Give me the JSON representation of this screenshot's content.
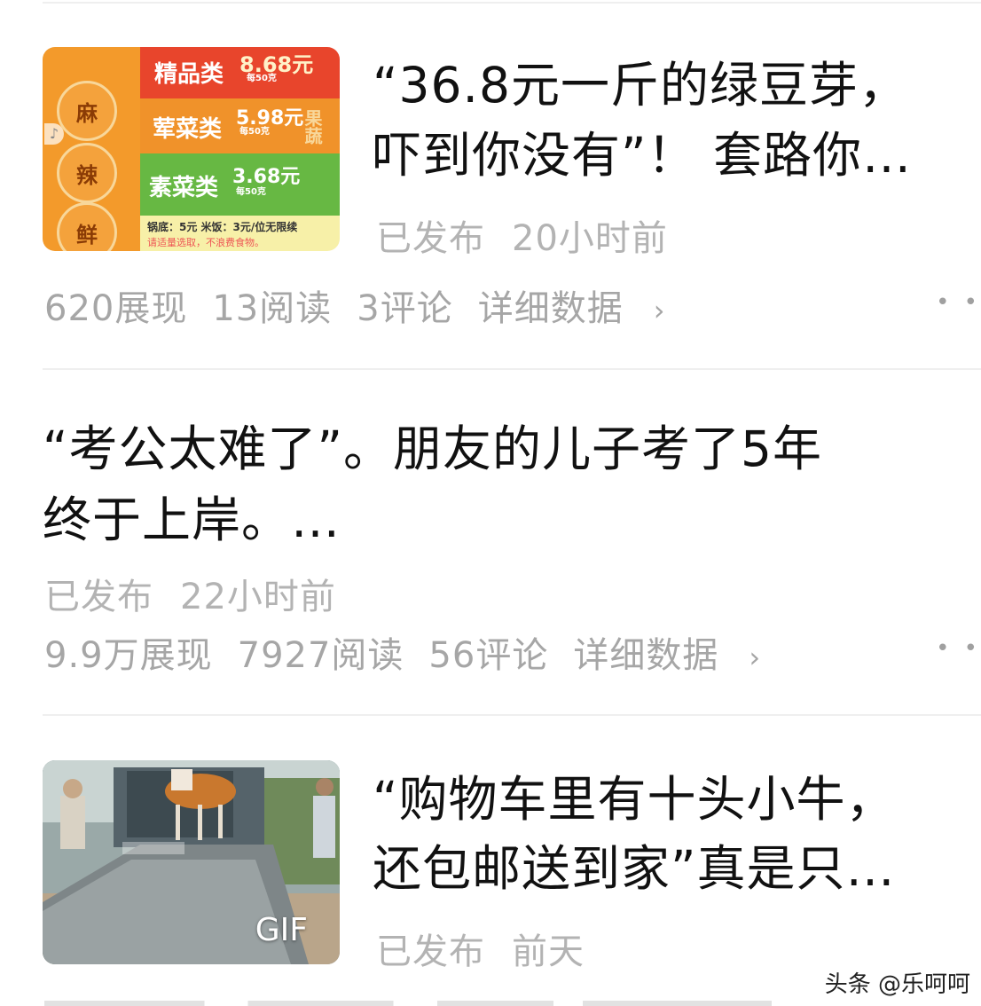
{
  "feed": {
    "items": [
      {
        "title_line1": "“36.8元一斤的绿豆芽，",
        "title_line2": "吓到你没有”！ 套路你…",
        "status": "已发布",
        "time": "20小时前",
        "stats": [
          "620展现",
          "13阅读",
          "3评论",
          "详细数据"
        ],
        "thumb": {
          "badges": [
            "麻",
            "辣",
            "鲜"
          ],
          "bands": [
            {
              "name": "精品类",
              "price": "8.68元",
              "unit": "每50克",
              "color": "#e8452c"
            },
            {
              "name": "荤菜类",
              "price": "5.98元",
              "unit": "每50克",
              "color": "#f0922a"
            },
            {
              "name": "素菜类",
              "price": "3.68元",
              "unit": "每50克",
              "color": "#67b843"
            }
          ],
          "footer": "锅底：5元  米饭：3元/位无限续",
          "footer2": "请适量选取，不浪费食物。",
          "side_text": "果蔬"
        }
      },
      {
        "title_line1": "“考公太难了”。朋友的儿子考了5年",
        "title_line2": "终于上岸。…",
        "status": "已发布",
        "time": "22小时前",
        "stats": [
          "9.9万展现",
          "7927阅读",
          "56评论",
          "详细数据"
        ]
      },
      {
        "title_line1": "“购物车里有十头小牛，",
        "title_line2": "还包邮送到家”真是只…",
        "status": "已发布",
        "time": "前天",
        "thumb": {
          "badge": "GIF"
        }
      }
    ]
  },
  "watermark": "头条 @乐呵呵",
  "more_icon": "ellipsis-icon"
}
